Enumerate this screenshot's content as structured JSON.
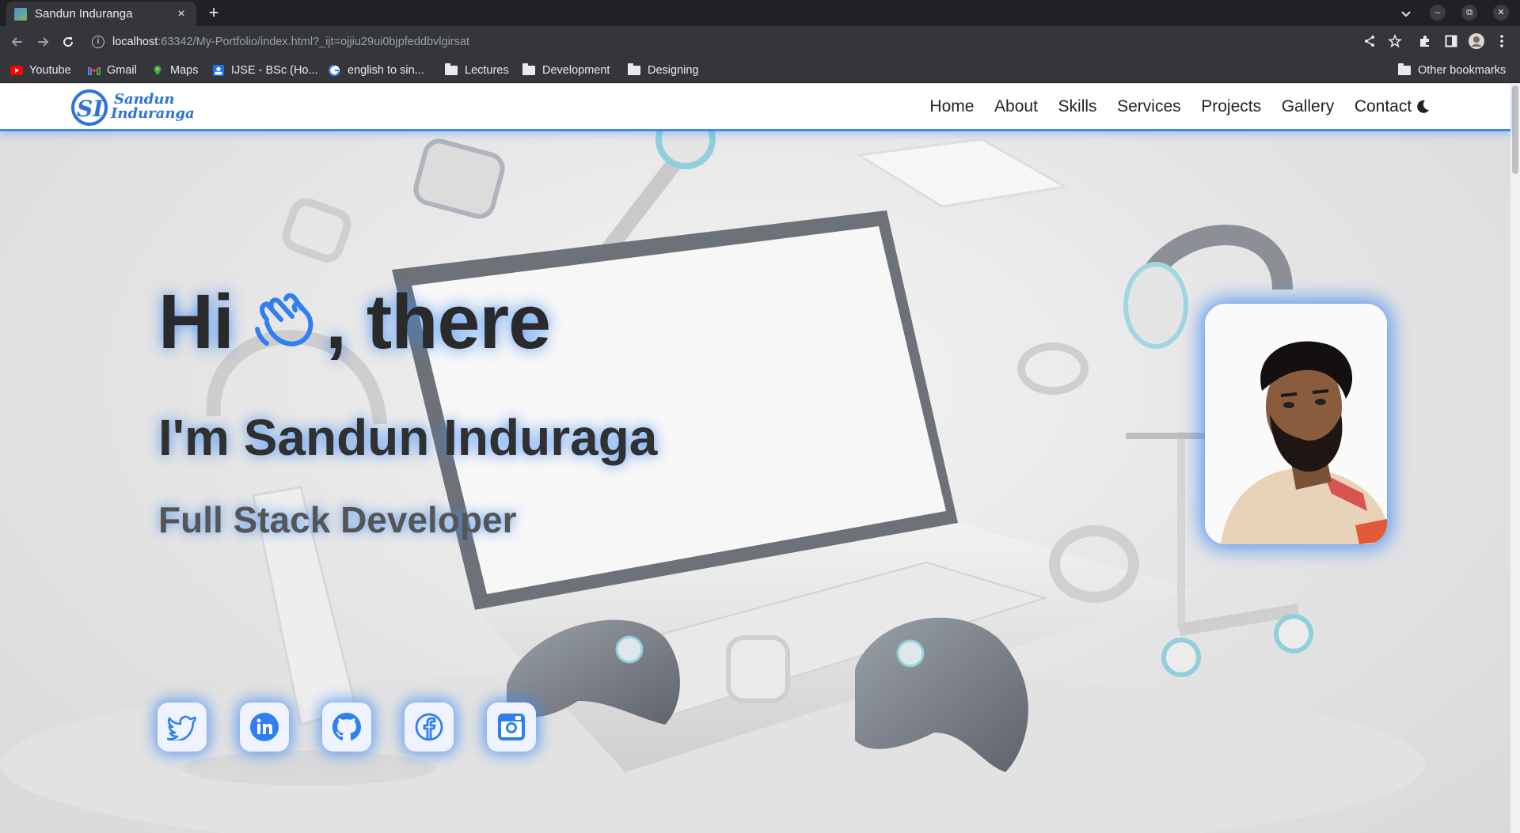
{
  "browser": {
    "tab_title": "Sandun Induranga",
    "tab_close": "×",
    "new_tab": "+",
    "url_host": "localhost",
    "url_rest": ":63342/My-Portfolio/index.html?_ijt=ojjiu29ui0bjpfeddbvlgirsat",
    "window_min": "–",
    "window_restore": "⧉",
    "window_close": "✕",
    "bookmarks": [
      {
        "label": "Youtube",
        "icon": "youtube-icon"
      },
      {
        "label": "Gmail",
        "icon": "gmail-icon"
      },
      {
        "label": "Maps",
        "icon": "maps-icon"
      },
      {
        "label": "IJSE - BSc (Ho...",
        "icon": "ijse-icon"
      },
      {
        "label": "english to sin...",
        "icon": "google-icon"
      },
      {
        "label": "Lectures",
        "icon": "folder-icon"
      },
      {
        "label": "Development",
        "icon": "folder-icon"
      },
      {
        "label": "Designing",
        "icon": "folder-icon"
      }
    ],
    "other_bookmarks": "Other bookmarks"
  },
  "site": {
    "logo_line1": "Sandun",
    "logo_line2": "Induranga",
    "logo_monogram": "SI",
    "nav": [
      "Home",
      "About",
      "Skills",
      "Services",
      "Projects",
      "Gallery",
      "Contact"
    ],
    "theme_icon": "moon-icon",
    "hero": {
      "greeting_hi": "Hi",
      "greeting_there": ", there",
      "name": "I'm Sandun Induraga",
      "role": "Full Stack Developer"
    },
    "socials": [
      "twitter-icon",
      "linkedin-icon",
      "github-icon",
      "facebook-icon",
      "instagram-icon"
    ],
    "colors": {
      "accent": "#3d8af7",
      "navbar_bg": "#ffffff",
      "text_dark": "#2a2a2a",
      "chrome_dark": "#35363a"
    }
  }
}
